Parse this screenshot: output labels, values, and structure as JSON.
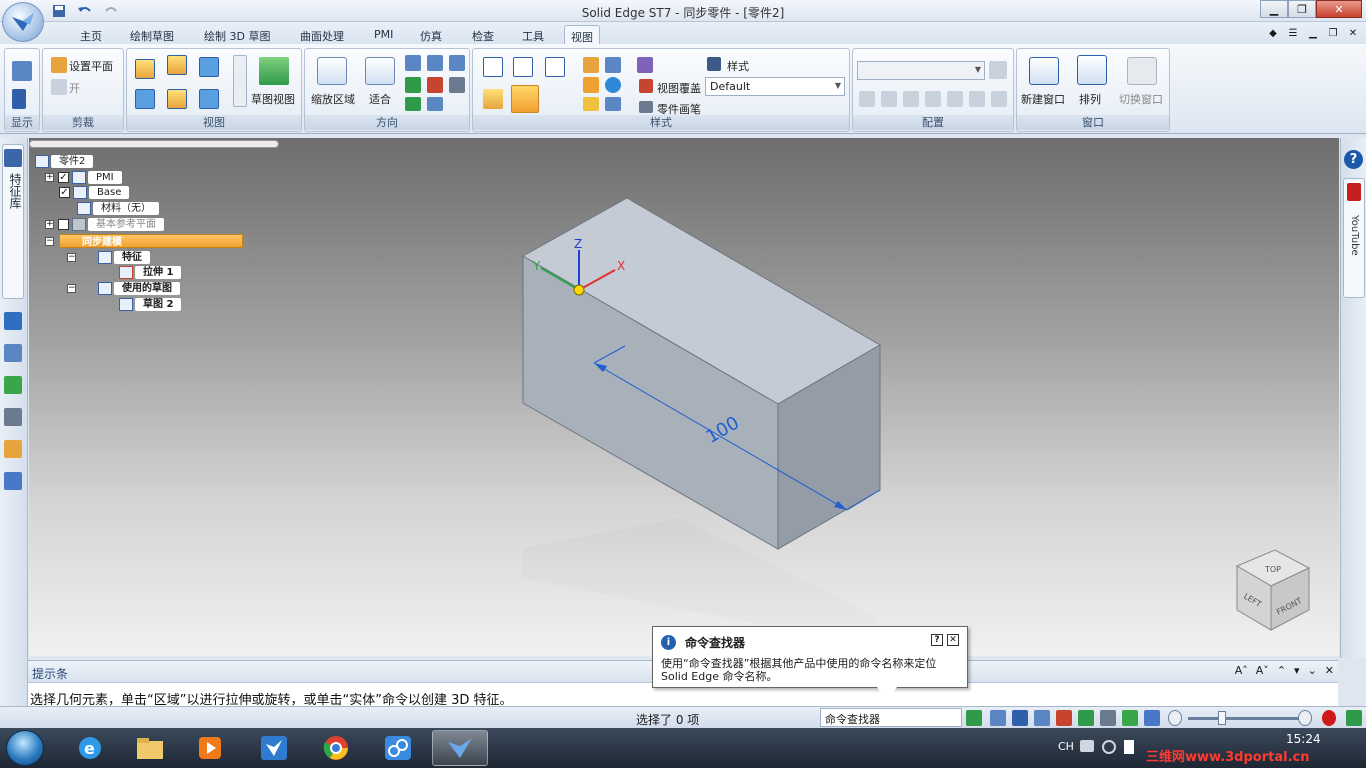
{
  "window": {
    "title": "Solid Edge ST7 - 同步零件 - [零件2]"
  },
  "tabs": [
    {
      "label": "主页"
    },
    {
      "label": "绘制草图"
    },
    {
      "label": "绘制 3D 草图"
    },
    {
      "label": "曲面处理"
    },
    {
      "label": "PMI"
    },
    {
      "label": "仿真"
    },
    {
      "label": "检查"
    },
    {
      "label": "工具"
    },
    {
      "label": "视图"
    }
  ],
  "ribbon": {
    "groups": {
      "show": "显示",
      "clip": "剪裁",
      "view": "视图",
      "orient": "方向",
      "style": "样式",
      "config": "配置",
      "window": "窗口"
    },
    "clip": {
      "set_plane": "设置平面",
      "on": "开"
    },
    "view": {
      "sketch_view": "草图视图"
    },
    "orient": {
      "zoom_area": "缩放区域",
      "fit": "适合"
    },
    "style": {
      "styles": "样式",
      "view_overlay": "视图覆盖",
      "part_painter": "零件画笔",
      "style_select": "Default"
    },
    "window": {
      "new_window": "新建窗口",
      "arrange": "排列",
      "switch_window": "切换窗口"
    }
  },
  "leftstrip": {
    "feature_tab": "特征库"
  },
  "rightstrip": {
    "youtube": "YouTube"
  },
  "tree": {
    "root": "零件2",
    "pmi": "PMI",
    "base": "Base",
    "material": "材料（无）",
    "ref_planes": "基本参考平面",
    "sync": "同步建模",
    "features": "特征",
    "extrude": "拉伸  1",
    "used_sketches": "使用的草图",
    "sketch": "草图  2"
  },
  "model": {
    "dimension": "100",
    "axes": {
      "x": "X",
      "y": "Y",
      "z": "Z"
    },
    "viewcube": {
      "top": "TOP",
      "front": "FRONT",
      "left": "LEFT"
    }
  },
  "promptbar": {
    "title": "提示条",
    "text": "选择几何元素，单击“区域”以进行拉伸或旋转，或单击“实体”命令以创建 3D 特征。"
  },
  "popup": {
    "title": "命令查找器",
    "body": "使用“命令查找器”根据其他产品中使用的命令名称来定位 Solid Edge 命令名称。"
  },
  "statusbar": {
    "selection": "选择了 0 项",
    "command_finder": "命令查找器"
  },
  "taskbar": {
    "lang": "CH",
    "time": "15:24",
    "watermark": "三维网www.3dportal.cn"
  }
}
